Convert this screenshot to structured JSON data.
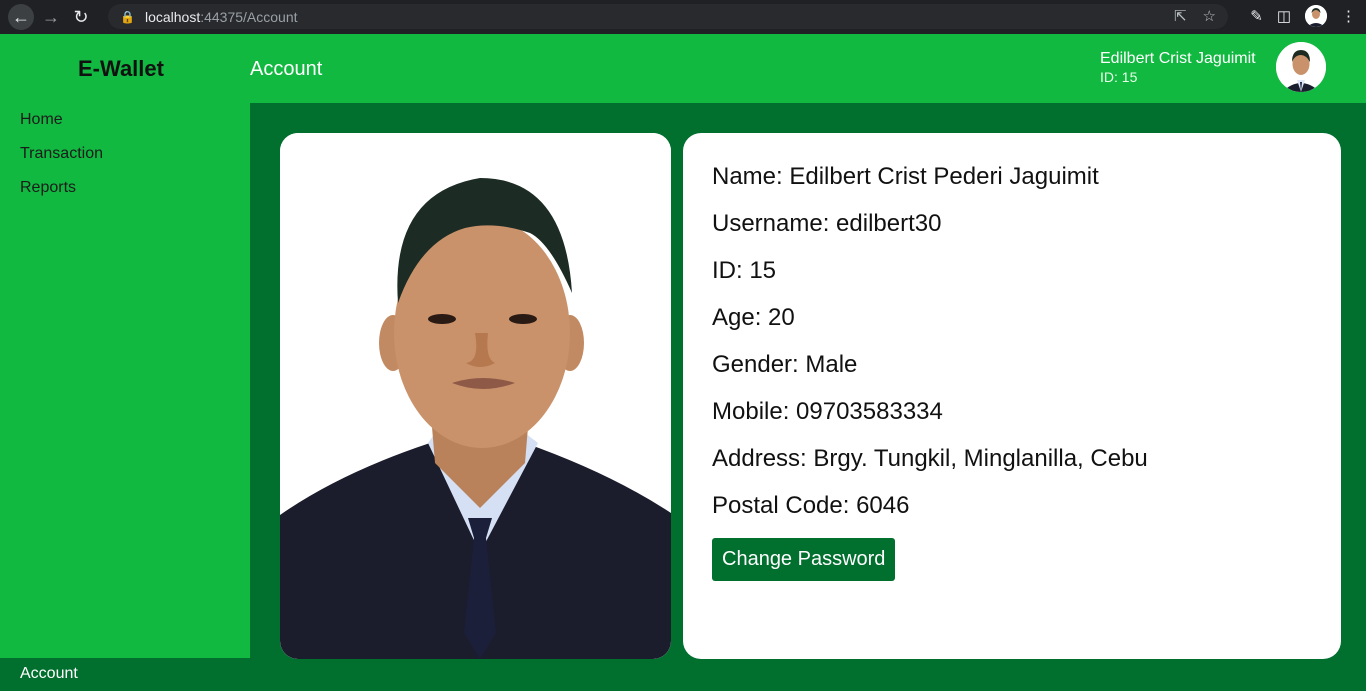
{
  "browser": {
    "url_host": "localhost",
    "url_path": ":44375/Account"
  },
  "app": {
    "brand": "E-Wallet",
    "page_title": "Account"
  },
  "user": {
    "display_name": "Edilbert Crist Jaguimit",
    "id_label": "ID: 15"
  },
  "sidebar": {
    "items": [
      {
        "label": "Home"
      },
      {
        "label": "Transaction"
      },
      {
        "label": "Reports"
      }
    ],
    "bottom_label": "Account"
  },
  "profile": {
    "lines": [
      "Name: Edilbert Crist Pederi Jaguimit",
      "Username: edilbert30",
      "ID: 15",
      "Age: 20",
      "Gender: Male",
      "Mobile: 09703583334",
      "Address: Brgy. Tungkil, Minglanilla, Cebu",
      "Postal Code: 6046"
    ],
    "change_password_label": "Change Password"
  },
  "colors": {
    "primary_green": "#11b941",
    "dark_green": "#016f2e"
  }
}
